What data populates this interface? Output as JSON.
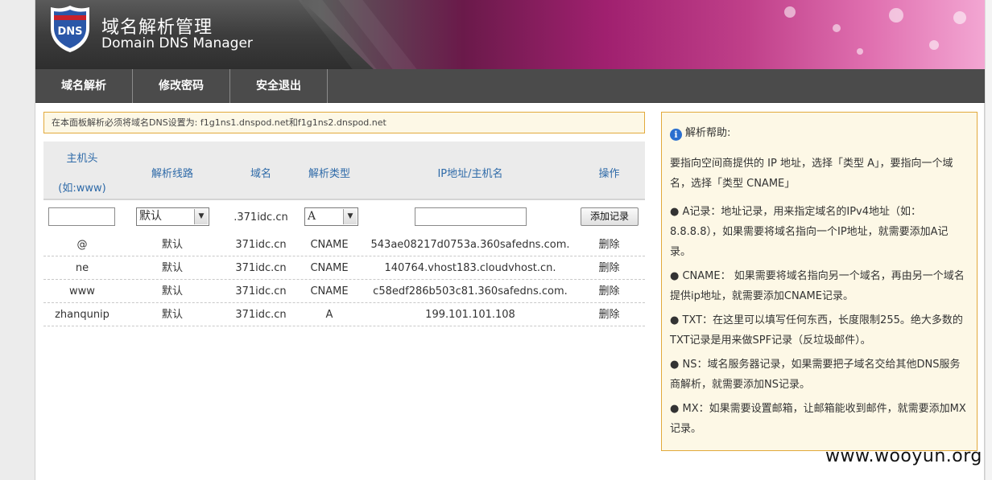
{
  "header": {
    "title_cn": "域名解析管理",
    "title_en": "Domain DNS Manager",
    "logo_text": "DNS"
  },
  "nav": {
    "items": [
      "域名解析",
      "修改密码",
      "安全退出"
    ]
  },
  "notice": "在本面板解析必须将域名DNS设置为: f1g1ns1.dnspod.net和f1g1ns2.dnspod.net",
  "table": {
    "headers": {
      "host": "主机头",
      "host_hint": "(如:www)",
      "line": "解析线路",
      "domain": "域名",
      "type": "解析类型",
      "value": "IP地址/主机名",
      "action": "操作"
    },
    "input": {
      "host": "",
      "line": "默认",
      "domain": ".371idc.cn",
      "type": "A",
      "value": "",
      "add_button": "添加记录"
    },
    "rows": [
      {
        "host": "@",
        "line": "默认",
        "domain": "371idc.cn",
        "type": "CNAME",
        "value": "543ae08217d0753a.360safedns.com.",
        "action": "删除"
      },
      {
        "host": "ne",
        "line": "默认",
        "domain": "371idc.cn",
        "type": "CNAME",
        "value": "140764.vhost183.cloudvhost.cn.",
        "action": "删除"
      },
      {
        "host": "www",
        "line": "默认",
        "domain": "371idc.cn",
        "type": "CNAME",
        "value": "c58edf286b503c81.360safedns.com.",
        "action": "删除"
      },
      {
        "host": "zhanqunip",
        "line": "默认",
        "domain": "371idc.cn",
        "type": "A",
        "value": "199.101.101.108",
        "action": "删除"
      }
    ]
  },
  "help": {
    "title": "解析帮助:",
    "intro": "要指向空间商提供的 IP 地址，选择「类型 A」，要指向一个域名，选择「类型 CNAME」",
    "items": [
      "A记录：地址记录，用来指定域名的IPv4地址（如：8.8.8.8），如果需要将域名指向一个IP地址，就需要添加A记录。",
      "CNAME： 如果需要将域名指向另一个域名，再由另一个域名提供ip地址，就需要添加CNAME记录。",
      "TXT：在这里可以填写任何东西，长度限制255。绝大多数的TXT记录是用来做SPF记录（反垃圾邮件）。",
      "NS：域名服务器记录，如果需要把子域名交给其他DNS服务商解析，就需要添加NS记录。",
      "MX：如果需要设置邮箱，让邮箱能收到邮件，就需要添加MX记录。"
    ]
  },
  "watermark": "www.wooyun.org"
}
